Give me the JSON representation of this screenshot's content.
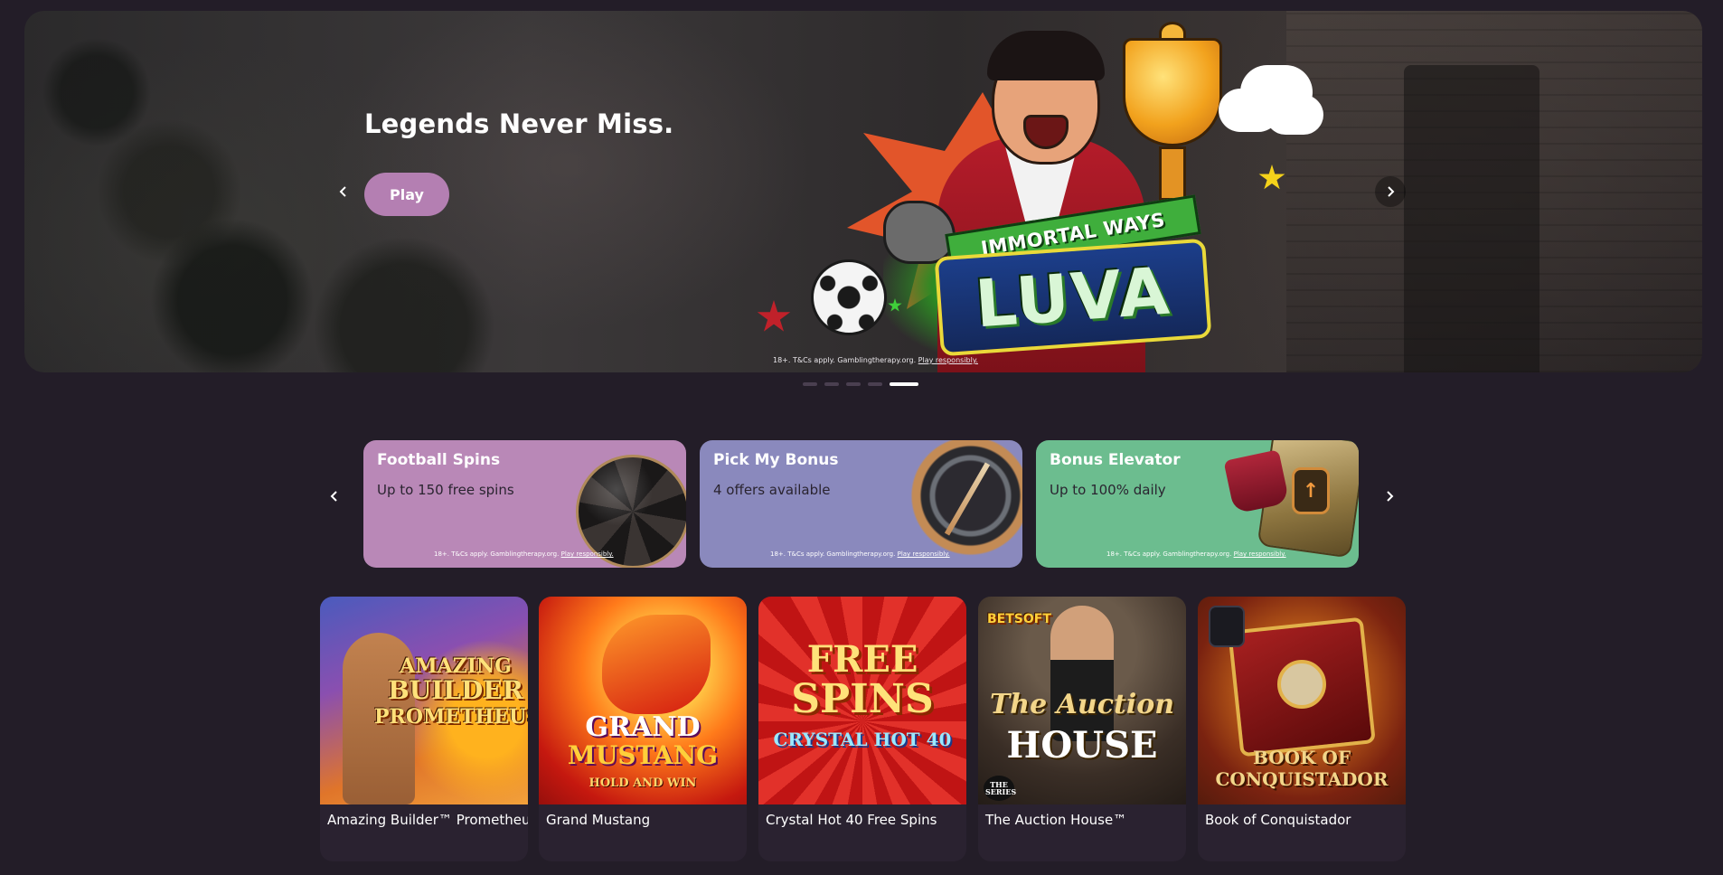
{
  "hero": {
    "title": "Legends Never Miss.",
    "play_label": "Play",
    "game_banner": "IMMORTAL WAYS",
    "game_logo": "LUVA",
    "tc_text": "18+. T&Cs apply. Gamblingtherapy.org.",
    "tc_link": "Play responsibly.",
    "slides_total": 5,
    "active_slide": 5
  },
  "promos": [
    {
      "title": "Football Spins",
      "subtitle": "Up to 150 free spins",
      "tc_text": "18+. T&Cs apply. Gamblingtherapy.org.",
      "tc_link": "Play responsibly.",
      "color": "#b988b7"
    },
    {
      "title": "Pick My Bonus",
      "subtitle": "4 offers available",
      "tc_text": "18+. T&Cs apply. Gamblingtherapy.org.",
      "tc_link": "Play responsibly.",
      "color": "#8a89bd"
    },
    {
      "title": "Bonus Elevator",
      "subtitle": "Up to 100% daily",
      "tc_text": "18+. T&Cs apply. Gamblingtherapy.org.",
      "tc_link": "Play responsibly.",
      "color": "#6cbd8f"
    }
  ],
  "games": [
    {
      "name": "Amazing Builder™ Prometheus",
      "art_lines": [
        "AMAZING",
        "BUILDER",
        "PROMETHEUS"
      ]
    },
    {
      "name": "Grand Mustang",
      "art_lines": [
        "GRAND",
        "MUSTANG",
        "HOLD AND WIN"
      ]
    },
    {
      "name": "Crystal Hot 40 Free Spins",
      "art_lines": [
        "FREE",
        "SPINS",
        "CRYSTAL HOT 40"
      ]
    },
    {
      "name": "The Auction House™",
      "art_lines": [
        "BETSOFT",
        "The Auction",
        "HOUSE",
        "THE SERIES"
      ]
    },
    {
      "name": "Book of Conquistador",
      "art_lines": [
        "BOOK OF",
        "CONQUISTADOR"
      ]
    }
  ],
  "colors": {
    "background": "#231d28",
    "play_button": "#b47fb2",
    "dot_active": "#ffffff",
    "dot_inactive": "#4a3f50"
  },
  "icons": {
    "prev": "chevron-left-icon",
    "next": "chevron-right-icon"
  }
}
